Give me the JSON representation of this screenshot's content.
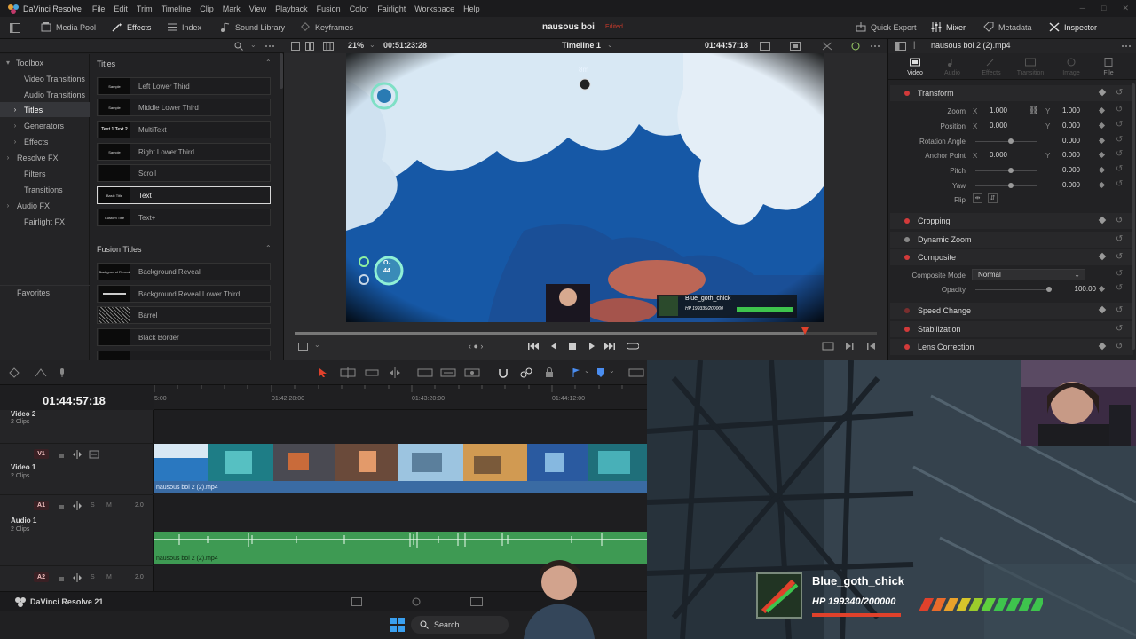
{
  "menubar": {
    "app_title": "DaVinci Resolve",
    "items": [
      "File",
      "Edit",
      "Trim",
      "Timeline",
      "Clip",
      "Mark",
      "View",
      "Playback",
      "Fusion",
      "Color",
      "Fairlight",
      "Workspace",
      "Help"
    ]
  },
  "toolbar": {
    "media_pool": "Media Pool",
    "effects": "Effects",
    "index": "Index",
    "sound_library": "Sound Library",
    "keyframes": "Keyframes",
    "project_name": "nausous boi",
    "project_status": "Edited",
    "quick_export": "Quick Export",
    "mixer": "Mixer",
    "metadata": "Metadata",
    "inspector": "Inspector"
  },
  "effects_panel": {
    "tree": [
      {
        "label": "Toolbox",
        "caret": "▾",
        "level": 0
      },
      {
        "label": "Video Transitions",
        "level": 1
      },
      {
        "label": "Audio Transitions",
        "level": 1
      },
      {
        "label": "Titles",
        "caret": "›",
        "level": 1,
        "selected": true
      },
      {
        "label": "Generators",
        "caret": "›",
        "level": 1
      },
      {
        "label": "Effects",
        "caret": "›",
        "level": 1
      },
      {
        "label": "Resolve FX",
        "caret": "›",
        "level": 0
      },
      {
        "label": "Filters",
        "level": 1
      },
      {
        "label": "Transitions",
        "level": 1
      },
      {
        "label": "Audio FX",
        "caret": "›",
        "level": 0
      },
      {
        "label": "Fairlight FX",
        "level": 1
      }
    ],
    "favorites": "Favorites",
    "titles_header": "Titles",
    "titles": [
      {
        "label": "Left Lower Third",
        "thumb": "Sample"
      },
      {
        "label": "Middle Lower Third",
        "thumb": "Sample"
      },
      {
        "label": "MultiText",
        "thumb": "Text 1 Text 2"
      },
      {
        "label": "Right Lower Third",
        "thumb": "Sample"
      },
      {
        "label": "Scroll",
        "thumb": ""
      },
      {
        "label": "Text",
        "thumb": "Basic Title",
        "selected": true
      },
      {
        "label": "Text+",
        "thumb": "Custom Title"
      }
    ],
    "fusion_header": "Fusion Titles",
    "fusion_titles": [
      {
        "label": "Background Reveal",
        "thumb": "Background Reveal"
      },
      {
        "label": "Background Reveal Lower Third",
        "thumb": ""
      },
      {
        "label": "Barrel",
        "thumb": ""
      },
      {
        "label": "Black Border",
        "thumb": ""
      }
    ]
  },
  "viewer": {
    "zoom": "21%",
    "timecode_left": "00:51:23:28",
    "timeline_name": "Timeline 1",
    "timecode_right": "01:44:57:18",
    "hud": {
      "depth": "8m",
      "oxygen_label": "O₂",
      "oxygen": "44",
      "streamer_name": "Blue_goth_chick",
      "hp": "HP 199335/200000"
    }
  },
  "inspector": {
    "clip_name": "nausous boi 2 (2).mp4",
    "tabs": [
      "Video",
      "Audio",
      "Effects",
      "Transition",
      "Image",
      "File"
    ],
    "transform": {
      "title": "Transform",
      "zoom_label": "Zoom",
      "zoom_x": "1.000",
      "zoom_y": "1.000",
      "position_label": "Position",
      "position_x": "0.000",
      "position_y": "0.000",
      "rotation_label": "Rotation Angle",
      "rotation": "0.000",
      "anchor_label": "Anchor Point",
      "anchor_x": "0.000",
      "anchor_y": "0.000",
      "pitch_label": "Pitch",
      "pitch": "0.000",
      "yaw_label": "Yaw",
      "yaw": "0.000",
      "flip_label": "Flip"
    },
    "sections": [
      "Cropping",
      "Dynamic Zoom",
      "Composite",
      "Speed Change",
      "Stabilization",
      "Lens Correction"
    ],
    "composite": {
      "mode_label": "Composite Mode",
      "mode": "Normal",
      "opacity_label": "Opacity",
      "opacity": "100.00"
    }
  },
  "timeline": {
    "timecode": "01:44:57:18",
    "ruler": [
      "5:00",
      "01:42:28:00",
      "01:43:20:00",
      "01:44:12:00"
    ],
    "tracks": {
      "video2_name": "Video 2",
      "video2_clips": "2 Clips",
      "v1_badge": "V1",
      "video1_name": "Video 1",
      "video1_clips": "2 Clips",
      "a1_badge": "A1",
      "a1_vol": "2.0",
      "audio1_name": "Audio 1",
      "audio1_clips": "2 Clips",
      "a2_badge": "A2",
      "a2_vol": "2.0",
      "solo": "S",
      "mute": "M"
    },
    "video_clip": "nausous boi 2 (2).mp4",
    "audio_clip": "nausous boi 2 (2).mp4"
  },
  "pagebar": {
    "brand": "DaVinci Resolve 21"
  },
  "taskbar": {
    "search": "Search"
  },
  "overlay": {
    "username": "Blue_goth_chick",
    "hp": "HP 199340/200000"
  }
}
